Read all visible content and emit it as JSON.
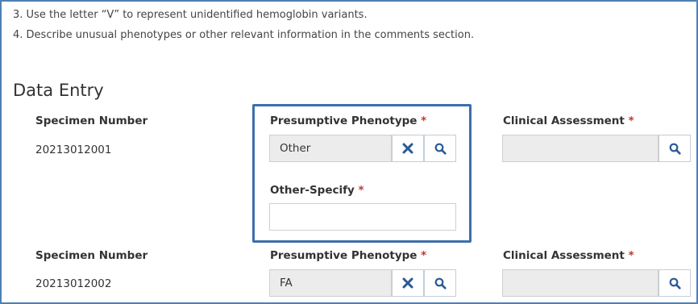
{
  "instructions": [
    "3. Use the letter “V” to represent unidentified hemoglobin variants.",
    "4. Describe unusual phenotypes or other relevant information in the comments section."
  ],
  "section_title": "Data Entry",
  "required_mark": "*",
  "rows": [
    {
      "specimen_label": "Specimen Number",
      "specimen_value": "20213012001",
      "phenotype_label": "Presumptive Phenotype",
      "phenotype_value": "Other",
      "other_specify_label": "Other-Specify",
      "other_specify_value": "",
      "assessment_label": "Clinical Assessment",
      "assessment_value": ""
    },
    {
      "specimen_label": "Specimen Number",
      "specimen_value": "20213012002",
      "phenotype_label": "Presumptive Phenotype",
      "phenotype_value": "FA",
      "assessment_label": "Clinical Assessment",
      "assessment_value": ""
    }
  ],
  "icons": {
    "clear": "close-icon",
    "lookup": "search-icon"
  },
  "colors": {
    "accent": "#2a5a94",
    "required": "#c0392b",
    "highlight_border": "#3b6faa"
  }
}
